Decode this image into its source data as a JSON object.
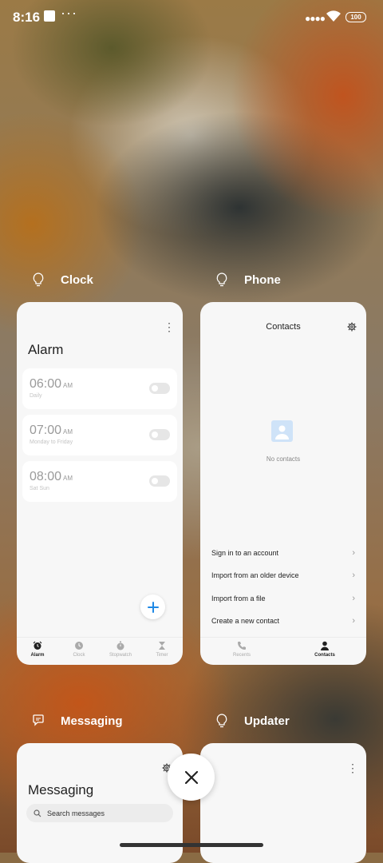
{
  "status_bar": {
    "time": "8:16",
    "more": "···",
    "signal": "●●●●",
    "battery": "100"
  },
  "recents": {
    "clock": {
      "app_name": "Clock",
      "screen_title": "Alarm",
      "alarms": [
        {
          "time": "06:00",
          "ampm": "AM",
          "repeat": "Daily",
          "enabled": false
        },
        {
          "time": "07:00",
          "ampm": "AM",
          "repeat": "Monday to Friday",
          "enabled": false
        },
        {
          "time": "08:00",
          "ampm": "AM",
          "repeat": "Sat Sun",
          "enabled": false
        }
      ],
      "nav": [
        {
          "label": "Alarm",
          "icon": "alarm-icon",
          "active": true
        },
        {
          "label": "Clock",
          "icon": "clock-icon",
          "active": false
        },
        {
          "label": "Stopwatch",
          "icon": "stopwatch-icon",
          "active": false
        },
        {
          "label": "Timer",
          "icon": "timer-icon",
          "active": false
        }
      ]
    },
    "phone": {
      "app_name": "Phone",
      "screen_title": "Contacts",
      "empty_text": "No contacts",
      "options": [
        "Sign in to an account",
        "Import from an older device",
        "Import from a file",
        "Create a new contact"
      ],
      "nav": [
        {
          "label": "Recents",
          "icon": "phone-icon",
          "active": false
        },
        {
          "label": "Contacts",
          "icon": "person-icon",
          "active": true
        }
      ]
    },
    "messaging": {
      "app_name": "Messaging",
      "screen_title": "Messaging",
      "search_placeholder": "Search messages"
    },
    "updater": {
      "app_name": "Updater"
    }
  },
  "colors": {
    "accent": "#1e88e5",
    "card_bg": "#f7f7f7"
  }
}
